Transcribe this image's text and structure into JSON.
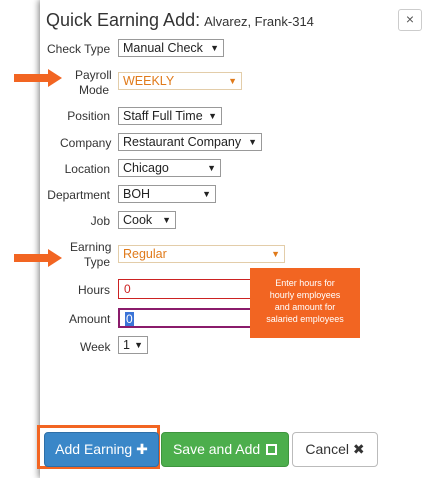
{
  "dialog": {
    "title": "Quick Earning Add:",
    "employee": "Alvarez, Frank-314",
    "close_glyph": "×"
  },
  "fields": {
    "check_type": {
      "label": "Check Type",
      "value": "Manual Check"
    },
    "payroll_mode": {
      "label_line1": "Payroll",
      "label_line2": "Mode",
      "value": "WEEKLY"
    },
    "position": {
      "label": "Position",
      "value": "Staff Full Time"
    },
    "company": {
      "label": "Company",
      "value": "Restaurant Company"
    },
    "location": {
      "label": "Location",
      "value": "Chicago"
    },
    "department": {
      "label": "Department",
      "value": "BOH"
    },
    "job": {
      "label": "Job",
      "value": "Cook"
    },
    "earning_type": {
      "label_line1": "Earning",
      "label_line2": "Type",
      "value": "Regular"
    },
    "hours": {
      "label": "Hours",
      "value": "0"
    },
    "amount": {
      "label": "Amount",
      "value": "0"
    },
    "week": {
      "label": "Week",
      "value": "1"
    }
  },
  "caret": "▼",
  "note": {
    "line1": "Enter hours for",
    "line2": "hourly employees",
    "line3": "and amount for",
    "line4": "salaried employees"
  },
  "buttons": {
    "add_earning": "Add Earning",
    "add_icon": "✚",
    "save_and_add": "Save and Add",
    "save_icon": "💾",
    "cancel": "Cancel",
    "cancel_icon": "✖"
  },
  "colors": {
    "callout_orange": "#f26522",
    "primary_blue": "#3a87c8",
    "success_green": "#4cae4c",
    "error_red": "#cc2222"
  },
  "icons": [
    "arrow-right-icon",
    "plus-icon",
    "floppy-disk-icon",
    "x-icon",
    "close-icon",
    "caret-down-icon"
  ]
}
